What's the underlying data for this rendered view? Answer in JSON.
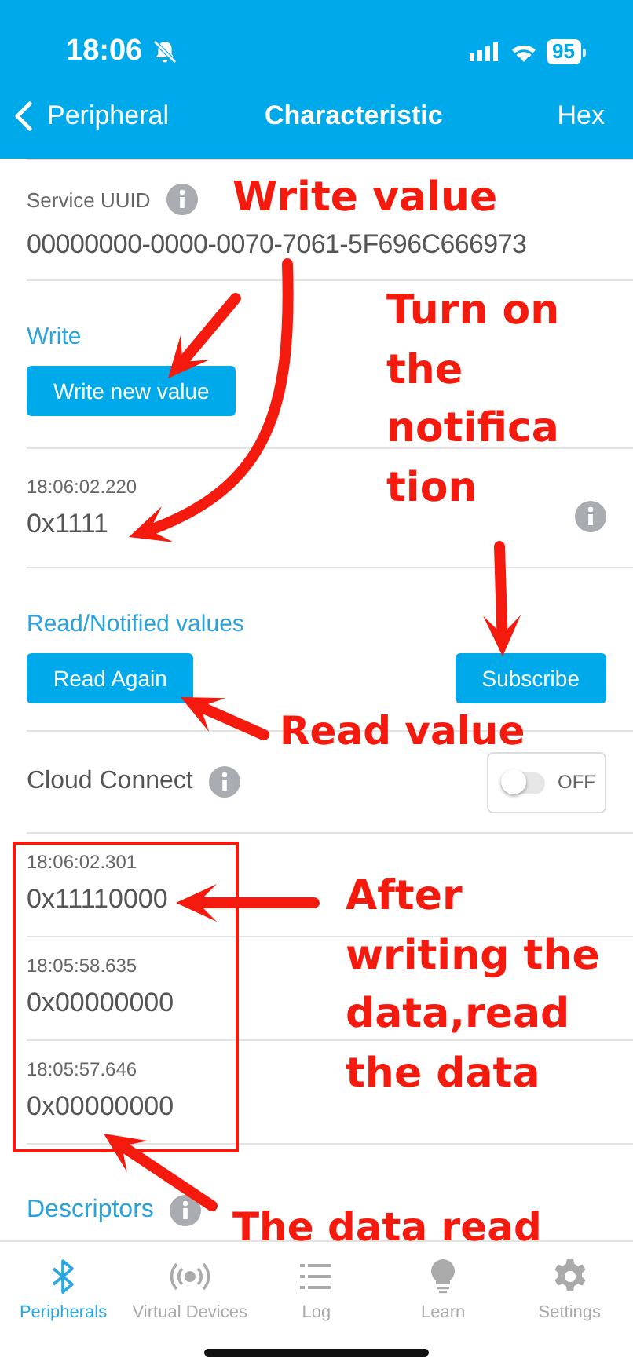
{
  "status_bar": {
    "time": "18:06",
    "battery": "95"
  },
  "nav": {
    "back": "Peripheral",
    "title": "Characteristic",
    "action": "Hex"
  },
  "service": {
    "label": "Service UUID",
    "uuid": "00000000-0000-0070-7061-5F696C666973"
  },
  "write": {
    "heading": "Write",
    "button": "Write new value",
    "last": {
      "time": "18:06:02.220",
      "value": "0x1111"
    }
  },
  "read": {
    "heading": "Read/Notified values",
    "read_button": "Read Again",
    "subscribe_button": "Subscribe"
  },
  "cloud": {
    "label": "Cloud Connect",
    "on": false,
    "state_label": "OFF"
  },
  "values": [
    {
      "time": "18:06:02.301",
      "value": "0x11110000"
    },
    {
      "time": "18:05:58.635",
      "value": "0x00000000"
    },
    {
      "time": "18:05:57.646",
      "value": "0x00000000"
    }
  ],
  "descriptors": {
    "heading": "Descriptors"
  },
  "tabs": [
    {
      "label": "Peripherals",
      "selected": true
    },
    {
      "label": "Virtual Devices",
      "selected": false
    },
    {
      "label": "Log",
      "selected": false
    },
    {
      "label": "Learn",
      "selected": false
    },
    {
      "label": "Settings",
      "selected": false
    }
  ],
  "annotations": [
    {
      "lines": [
        "Write value"
      ]
    },
    {
      "lines": [
        "Turn on",
        "the",
        "notifica",
        "tion"
      ]
    },
    {
      "lines": [
        "Read value"
      ]
    },
    {
      "lines": [
        "After",
        "writing the",
        "data,read",
        "the data"
      ]
    },
    {
      "lines": [
        "The data read"
      ]
    }
  ]
}
